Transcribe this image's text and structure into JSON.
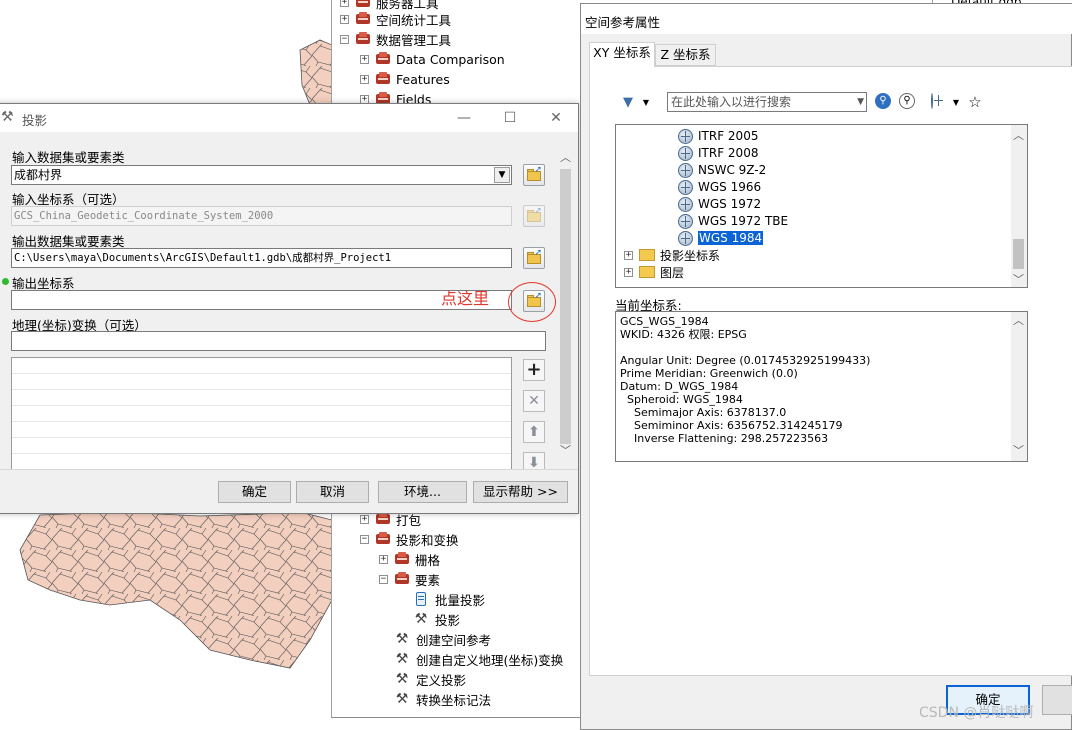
{
  "toolbox": {
    "items": [
      {
        "label": "服务器工具"
      },
      {
        "label": "空间统计工具"
      },
      {
        "label": "数据管理工具"
      },
      {
        "label": "Data Comparison"
      },
      {
        "label": "Features"
      },
      {
        "label": "Fields"
      }
    ],
    "lower_items": [
      {
        "label": "打包"
      },
      {
        "label": "投影和变换"
      },
      {
        "label": "栅格"
      },
      {
        "label": "要素"
      },
      {
        "label": "批量投影"
      },
      {
        "label": "投影"
      },
      {
        "label": "创建空间参考"
      },
      {
        "label": "创建自定义地理(坐标)变换"
      },
      {
        "label": "定义投影"
      },
      {
        "label": "转换坐标记法"
      }
    ],
    "folder_strip_label": "Default.gdb"
  },
  "project_dialog": {
    "title": "投影",
    "input_label": "输入数据集或要素类",
    "input_value": "成都村界",
    "input_cs_label": "输入坐标系（可选）",
    "input_cs_value": "GCS_China_Geodetic_Coordinate_System_2000",
    "output_label": "输出数据集或要素类",
    "output_value": "C:\\Users\\maya\\Documents\\ArcGIS\\Default1.gdb\\成都村界_Project1",
    "output_cs_label": "输出坐标系",
    "output_cs_value": "",
    "transform_label": "地理(坐标)变换（可选）",
    "transform_value": "",
    "buttons": {
      "ok": "确定",
      "cancel": "取消",
      "env": "环境...",
      "help": "显示帮助 >>"
    }
  },
  "annotation": {
    "text": "点这里",
    "color": "#e0382c"
  },
  "sr_dialog": {
    "title": "空间参考属性",
    "tabs": [
      "XY 坐标系",
      "Z 坐标系"
    ],
    "search_placeholder": "在此处输入以进行搜索",
    "tree_items": [
      {
        "label": "ITRF 2005",
        "type": "globe"
      },
      {
        "label": "ITRF 2008",
        "type": "globe"
      },
      {
        "label": "NSWC 9Z-2",
        "type": "globe"
      },
      {
        "label": "WGS 1966",
        "type": "globe"
      },
      {
        "label": "WGS 1972",
        "type": "globe"
      },
      {
        "label": "WGS 1972 TBE",
        "type": "globe"
      },
      {
        "label": "WGS 1984",
        "type": "globe",
        "selected": true
      },
      {
        "label": "投影坐标系",
        "type": "folder"
      },
      {
        "label": "图层",
        "type": "folder"
      }
    ],
    "current_label": "当前坐标系:",
    "current_lines": [
      "GCS_WGS_1984",
      "WKID: 4326 权限: EPSG",
      "",
      "Angular Unit: Degree (0.0174532925199433)",
      "Prime Meridian: Greenwich (0.0)",
      "Datum: D_WGS_1984",
      "  Spheroid: WGS_1984",
      "    Semimajor Axis: 6378137.0",
      "    Semiminor Axis: 6356752.314245179",
      "    Inverse Flattening: 298.257223563"
    ],
    "ok_label": "确定"
  },
  "watermark": "CSDN @肖哒哒啊",
  "colors": {
    "accent": "#0a64d6",
    "map_fill": "#f3cfc0",
    "map_stroke": "#555555"
  }
}
